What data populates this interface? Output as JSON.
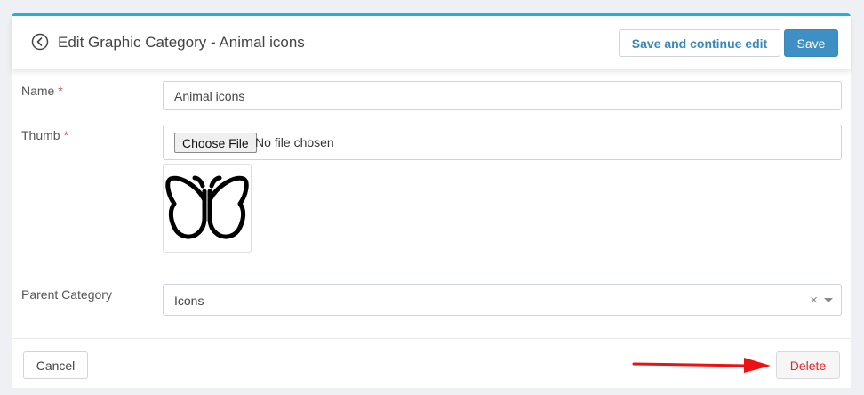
{
  "header": {
    "title": "Edit Graphic Category - Animal icons",
    "back_icon": "circle-chevron-left-icon",
    "save_continue_label": "Save and continue edit",
    "save_label": "Save"
  },
  "form": {
    "name": {
      "label": "Name",
      "required_mark": "*",
      "value": "Animal icons"
    },
    "thumb": {
      "label": "Thumb",
      "required_mark": "*",
      "choose_button_label": "Choose File",
      "file_status": "No file chosen",
      "preview_icon": "butterfly-icon"
    },
    "parent_category": {
      "label": "Parent Category",
      "selected_value": "Icons",
      "clear_symbol": "×"
    }
  },
  "footer": {
    "cancel_label": "Cancel",
    "delete_label": "Delete"
  },
  "colors": {
    "accent_top_border": "#1cb5df",
    "primary_button": "#3e8fc3",
    "link_blue": "#3a87b9",
    "required_red": "#d9534f",
    "delete_red": "#e0262a",
    "annotation_arrow": "#ee1111"
  }
}
